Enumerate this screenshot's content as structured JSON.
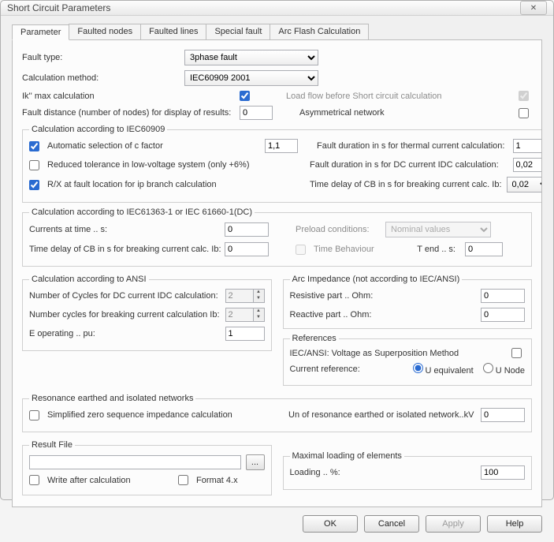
{
  "window": {
    "title": "Short Circuit Parameters",
    "close_glyph": "✕"
  },
  "tabs": [
    "Parameter",
    "Faulted nodes",
    "Faulted lines",
    "Special fault",
    "Arc Flash Calculation"
  ],
  "top": {
    "fault_type_label": "Fault type:",
    "fault_type_value": "3phase fault",
    "calc_method_label": "Calculation method:",
    "calc_method_value": "IEC60909 2001"
  },
  "row3": {
    "ikmax_label": "Ik'' max calculation",
    "ikmax_checked": true,
    "loadflow_label": "Load flow before Short circuit calculation",
    "loadflow_checked": true
  },
  "row4": {
    "fault_dist_label": "Fault distance (number of nodes) for display of results:",
    "fault_dist_value": "0",
    "asym_label": "Asymmetrical network",
    "asym_checked": false
  },
  "iec60909": {
    "legend": "Calculation according to IEC60909",
    "auto_c_label": "Automatic selection of c factor",
    "auto_c_checked": true,
    "auto_c_value": "1,1",
    "thermal_label": "Fault duration in s for thermal current calculation:",
    "thermal_value": "1",
    "reduced_label": "Reduced tolerance in low-voltage system (only +6%)",
    "reduced_checked": false,
    "dc_idc_label": "Fault duration in s for DC current IDC calculation:",
    "dc_idc_value": "0,02",
    "rx_label": "R/X at fault location for ip branch calculation",
    "rx_checked": true,
    "cb_delay_label": "Time delay of CB in s for breaking current calc. Ib:",
    "cb_delay_value": "0,02"
  },
  "iec61363": {
    "legend": "Calculation according to IEC61363-1 or IEC 61660-1(DC)",
    "currents_label": "Currents at time .. s:",
    "currents_value": "0",
    "preload_label": "Preload conditions:",
    "preload_value": "Nominal values",
    "cb_delay_label": "Time delay of CB in s for breaking current calc. Ib:",
    "cb_delay_value": "0",
    "time_beh_label": "Time Behaviour",
    "time_beh_checked": false,
    "tend_label": "T end .. s:",
    "tend_value": "0"
  },
  "ansi": {
    "legend": "Calculation according to ANSI",
    "cycles_idc_label": "Number of Cycles for DC current IDC calculation:",
    "cycles_idc_value": "2",
    "cycles_ib_label": "Number cycles for breaking current calculation Ib:",
    "cycles_ib_value": "2",
    "eop_label": "E operating .. pu:",
    "eop_value": "1"
  },
  "arc": {
    "legend": "Arc Impedance (not according to IEC/ANSI)",
    "res_label": "Resistive part .. Ohm:",
    "res_value": "0",
    "react_label": "Reactive part .. Ohm:",
    "react_value": "0"
  },
  "refs": {
    "legend": "References",
    "iec_ansi_label": "IEC/ANSI: Voltage as Superposition Method",
    "iec_ansi_checked": false,
    "curr_ref_label": "Current reference:",
    "opt1": "U equivalent",
    "opt2": "U Node"
  },
  "resonance": {
    "legend": "Resonance earthed and isolated networks",
    "simpl_label": "Simplified zero sequence impedance calculation",
    "simpl_checked": false,
    "un_label": "Un of resonance earthed or isolated network..kV",
    "un_value": "0"
  },
  "resultfile": {
    "legend": "Result File",
    "path": "",
    "browse": "...",
    "write_label": "Write after calculation",
    "write_checked": false,
    "format4x_label": "Format 4.x",
    "format4x_checked": false
  },
  "maxload": {
    "legend": "Maximal loading of elements",
    "loading_label": "Loading .. %:",
    "loading_value": "100"
  },
  "buttons": {
    "ok": "OK",
    "cancel": "Cancel",
    "apply": "Apply",
    "help": "Help"
  }
}
